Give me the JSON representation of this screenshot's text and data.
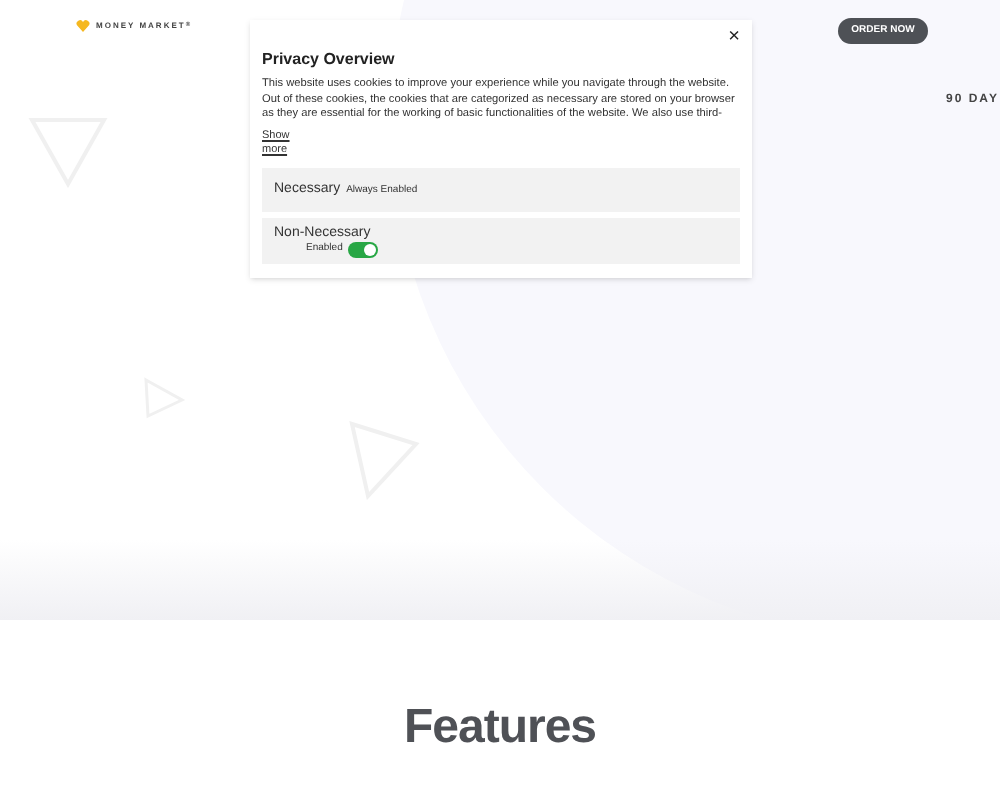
{
  "header": {
    "logo": "MONEY MARKET$^{®}$",
    "order_button": "ORDER NOW"
  },
  "hero": {
    "tagline": "90 DAY"
  },
  "features": {
    "title": "Features"
  },
  "privacy_modal": {
    "title": "Privacy Overview",
    "close": "×",
    "body": "This website uses cookies to improve your experience while you navigate through the website. Out of these cookies, the cookies that are categorized as necessary are stored on your browser as they are essential for the working of basic functionalities of the website. We also use third-",
    "show_more": "Show more",
    "categories": [
      {
        "kind": "fixed",
        "name": "Necessary",
        "status": "Always Enabled"
      },
      {
        "kind": "toggle",
        "name": "Non-Necessary",
        "status": "Enabled",
        "on": true
      }
    ]
  }
}
